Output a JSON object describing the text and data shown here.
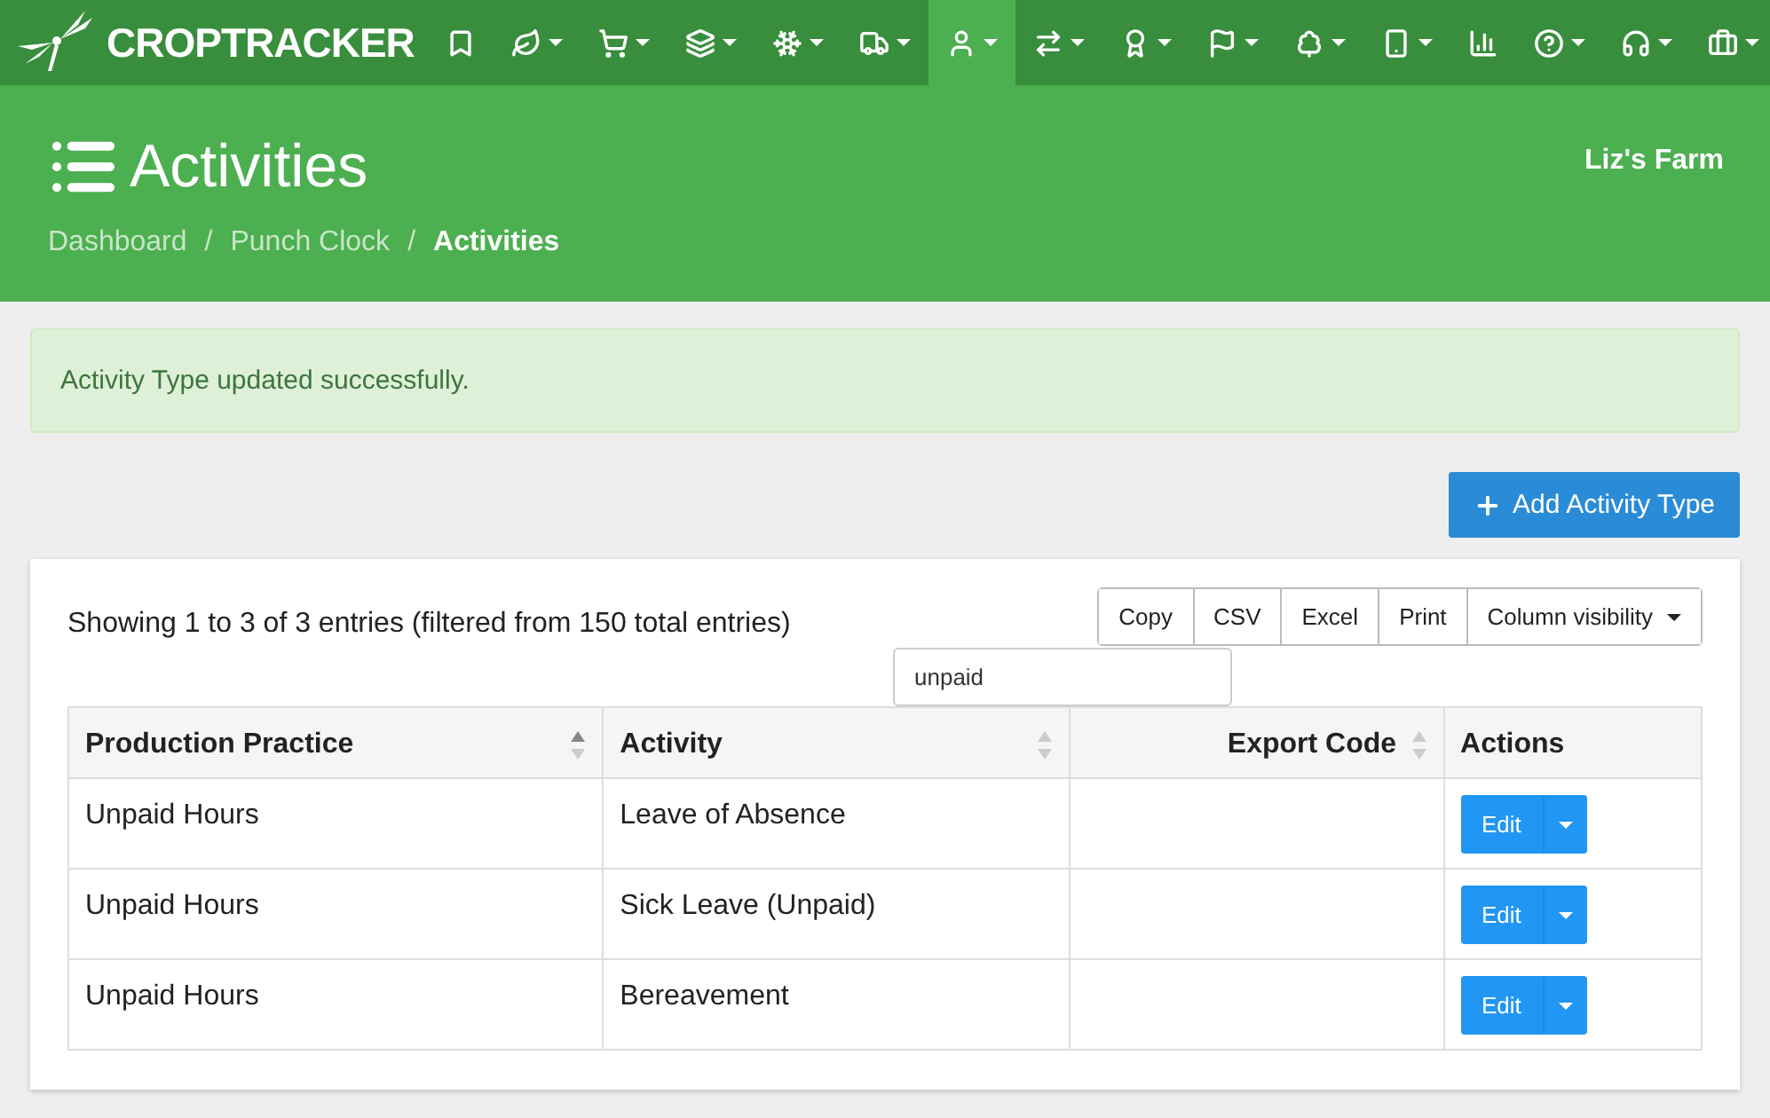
{
  "navbar": {
    "brand": "CROPTRACKER",
    "items": [
      {
        "dropdown": false,
        "selected": false
      },
      {
        "dropdown": true,
        "selected": false
      },
      {
        "dropdown": true,
        "selected": false
      },
      {
        "dropdown": true,
        "selected": false
      },
      {
        "dropdown": true,
        "selected": false
      },
      {
        "dropdown": true,
        "selected": false
      },
      {
        "dropdown": true,
        "selected": true
      },
      {
        "dropdown": true,
        "selected": false
      },
      {
        "dropdown": true,
        "selected": false
      },
      {
        "dropdown": true,
        "selected": false
      },
      {
        "dropdown": true,
        "selected": false
      },
      {
        "dropdown": true,
        "selected": false
      },
      {
        "dropdown": false,
        "selected": false
      }
    ],
    "right_items": [
      {
        "dropdown": true,
        "selected": false
      },
      {
        "dropdown": true,
        "selected": false
      },
      {
        "dropdown": true,
        "selected": false
      }
    ]
  },
  "header": {
    "title": "Activities",
    "farm": "Liz's Farm",
    "breadcrumb": [
      {
        "label": "Dashboard",
        "current": false
      },
      {
        "label": "Punch Clock",
        "current": false
      },
      {
        "label": "Activities",
        "current": true
      }
    ],
    "separator": "/"
  },
  "alert": "Activity Type updated successfully.",
  "add_button": "Add Activity Type",
  "table": {
    "info": "Showing 1 to 3 of 3 entries (filtered from 150 total entries)",
    "search": "unpaid",
    "export_buttons": [
      "Copy",
      "CSV",
      "Excel",
      "Print"
    ],
    "column_visibility": "Column visibility",
    "columns": [
      {
        "label": "Production Practice",
        "kind": "text",
        "sortable": true,
        "sorted": true
      },
      {
        "label": "Activity",
        "kind": "text",
        "sortable": true,
        "sorted": false
      },
      {
        "label": "Export Code",
        "kind": "code",
        "sortable": true,
        "sorted": false
      },
      {
        "label": "Actions",
        "kind": "actions",
        "sortable": false
      }
    ],
    "rows": [
      {
        "practice": "Unpaid Hours",
        "activity": "Leave of Absence",
        "action": "Edit"
      },
      {
        "practice": "Unpaid Hours",
        "activity": "Sick Leave (Unpaid)",
        "action": "Edit"
      },
      {
        "practice": "Unpaid Hours",
        "activity": "Bereavement",
        "action": "Edit"
      }
    ]
  }
}
